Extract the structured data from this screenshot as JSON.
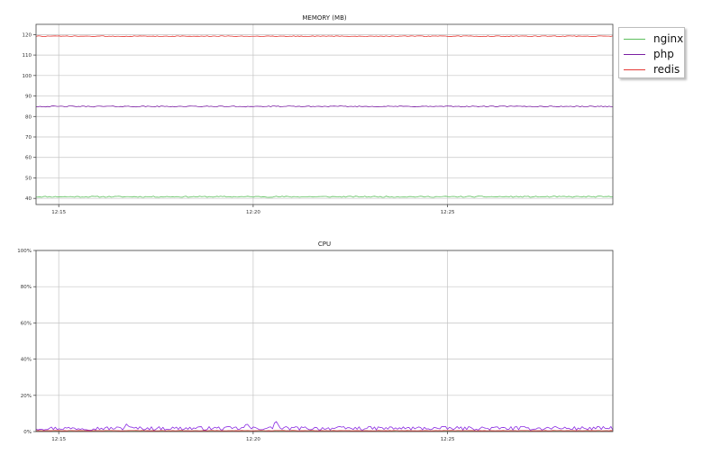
{
  "colors": {
    "nginx": "#5cbf5c",
    "php": "#7b1fa2",
    "redis": "#e53935",
    "cpu_php": "#8a2be2"
  },
  "legend": {
    "placement": "outside-top-right",
    "items": [
      {
        "key": "nginx",
        "label": "nginx"
      },
      {
        "key": "php",
        "label": "php"
      },
      {
        "key": "redis",
        "label": "redis"
      }
    ]
  },
  "chart_data": [
    {
      "type": "line",
      "title": "MEMORY (MB)",
      "xlabel": "",
      "ylabel": "",
      "x_start": "12:14:25",
      "x_end": "12:29:15",
      "x_ticks": [
        "12:15",
        "12:20",
        "12:25"
      ],
      "ylim": [
        37,
        125
      ],
      "y_ticks": [
        40,
        50,
        60,
        70,
        80,
        90,
        100,
        110,
        120
      ],
      "y_tick_labels": [
        "40",
        "50",
        "60",
        "70",
        "80",
        "90",
        "100",
        "110",
        "120"
      ],
      "grid": true,
      "series": [
        {
          "name": "nginx",
          "color": "#5cbf5c",
          "base": 40.8,
          "noise": 0.3
        },
        {
          "name": "php",
          "color": "#7b1fa2",
          "base": 84.9,
          "noise": 0.25
        },
        {
          "name": "redis",
          "color": "#e53935",
          "base": 119.2,
          "noise": 0.2
        }
      ]
    },
    {
      "type": "line",
      "title": "CPU",
      "xlabel": "",
      "ylabel": "",
      "x_start": "12:14:25",
      "x_end": "12:29:15",
      "x_ticks": [
        "12:15",
        "12:20",
        "12:25"
      ],
      "ylim": [
        0,
        100
      ],
      "y_ticks": [
        0,
        20,
        40,
        60,
        80,
        100
      ],
      "y_tick_labels": [
        "0%",
        "20%",
        "40%",
        "60%",
        "80%",
        "100%"
      ],
      "grid": true,
      "series": [
        {
          "name": "php",
          "color": "#8a2be2",
          "base": 1.8,
          "noise": 1.0,
          "spikes": [
            [
              "12:16:45",
              4.5
            ],
            [
              "12:19:50",
              4.8
            ],
            [
              "12:20:35",
              6.0
            ],
            [
              "12:27:45",
              3.5
            ]
          ]
        },
        {
          "name": "nginx",
          "color": "#5cbf5c",
          "base": 0.35,
          "noise": 0.15
        },
        {
          "name": "redis",
          "color": "#e53935",
          "base": 0.5,
          "noise": 0.1
        }
      ]
    }
  ]
}
